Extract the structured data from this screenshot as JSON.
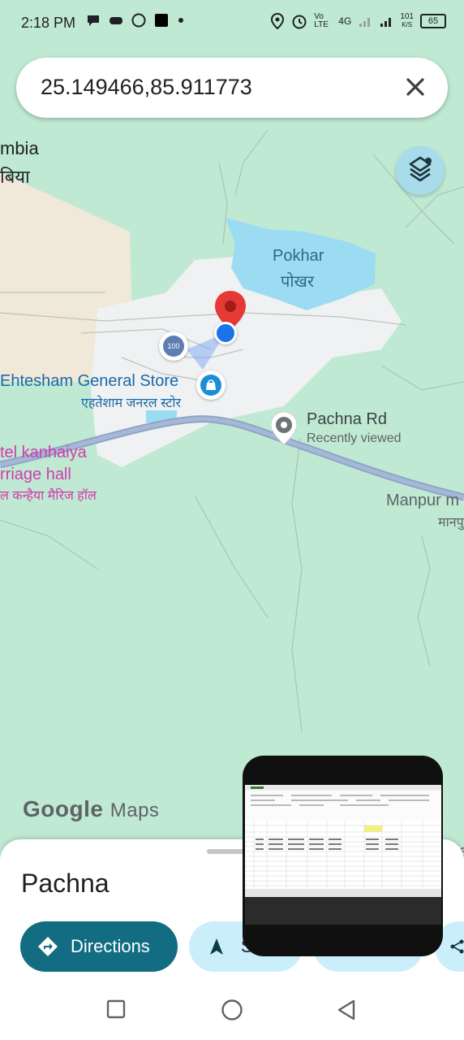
{
  "status": {
    "time": "2:18 PM",
    "network_right": "Vo LTE",
    "network_4g": "4G",
    "speed_value": "101",
    "speed_unit": "K/S",
    "battery": "65"
  },
  "search": {
    "query": "25.149466,85.911773"
  },
  "map": {
    "label_mbia": "mbia",
    "label_mbia_hi": "बिया",
    "lake_name": "Pokhar",
    "lake_name_hi": "पोखर",
    "store_name": "Ehtesham General Store",
    "store_name_hi": "एहतेशाम जनरल स्टोर",
    "road_name": "Pachna Rd",
    "road_sub": "Recently viewed",
    "hotel_line1": "tel kanhaiya",
    "hotel_line2": "rriage hall",
    "hotel_hi": "ल कन्हैया मैरिज हॉल",
    "manpur": "Manpur m",
    "manpur_hi": "मानपु",
    "ha": "Ha",
    "atm_badge": "100"
  },
  "logo": {
    "google": "Google",
    "maps": "Maps"
  },
  "sheet": {
    "place_name": "Pachna",
    "directions_label": "Directions",
    "start_label": "S"
  },
  "colors": {
    "map_bg": "#bfe9d3",
    "lake": "#9bdcf2",
    "settlement": "#f0f1f2",
    "directions_chip": "#126d83",
    "pin_red": "#e53935",
    "location_blue": "#1a73e8",
    "store_label": "#1769aa",
    "hotel_label": "#d33bab"
  }
}
